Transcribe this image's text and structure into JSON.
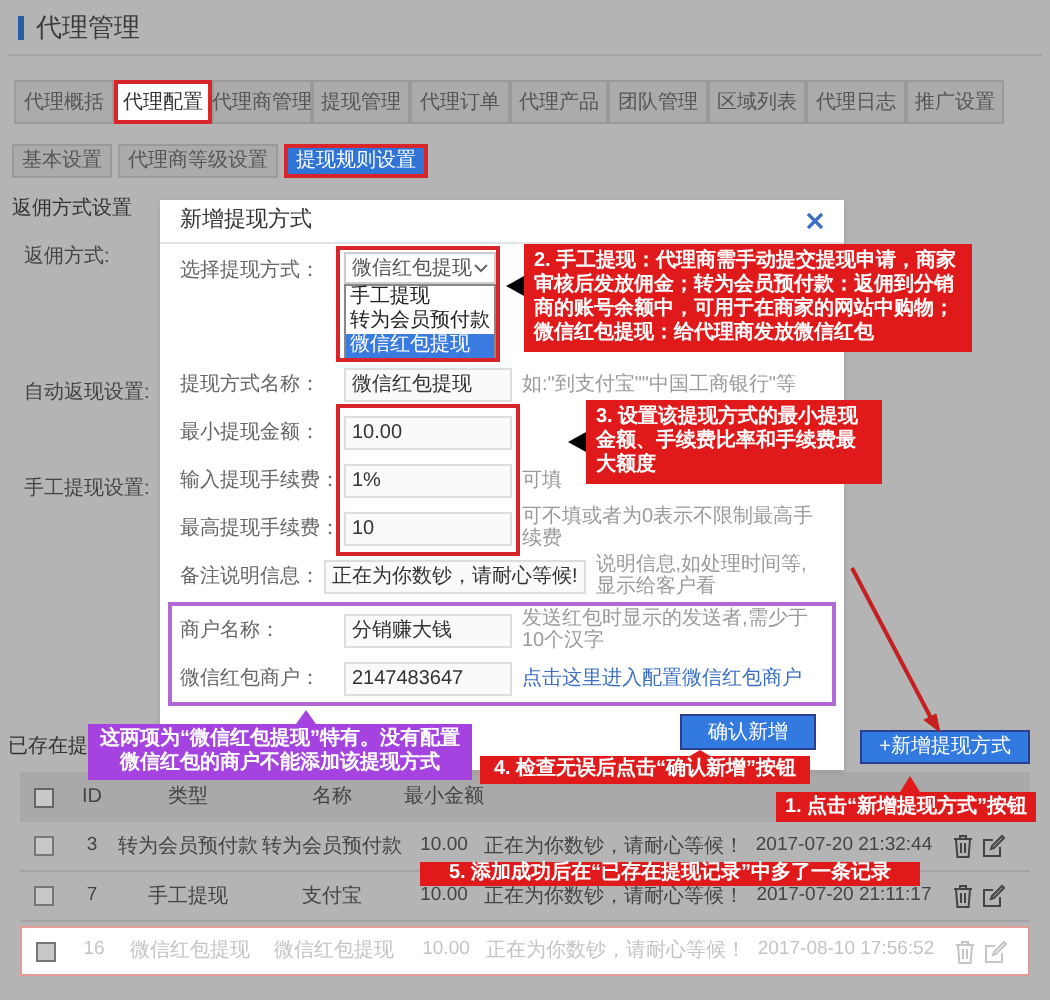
{
  "page_title": "代理管理",
  "tabs": [
    {
      "label": "代理概括",
      "selected": false
    },
    {
      "label": "代理配置",
      "selected": true
    },
    {
      "label": "代理商管理",
      "selected": false
    },
    {
      "label": "提现管理",
      "selected": false
    },
    {
      "label": "代理订单",
      "selected": false
    },
    {
      "label": "代理产品",
      "selected": false
    },
    {
      "label": "团队管理",
      "selected": false
    },
    {
      "label": "区域列表",
      "selected": false
    },
    {
      "label": "代理日志",
      "selected": false
    },
    {
      "label": "推广设置",
      "selected": false
    }
  ],
  "subtabs": [
    {
      "label": "基本设置",
      "selected": false
    },
    {
      "label": "代理商等级设置",
      "selected": false
    },
    {
      "label": "提现规则设置",
      "selected": true
    }
  ],
  "section_label": "返佣方式设置",
  "side_labels": [
    "返佣方式:",
    "自动返现设置:",
    "手工提现设置:"
  ],
  "records_label": "已存在提",
  "modal": {
    "title": "新增提现方式",
    "select": {
      "label": "选择提现方式：",
      "value": "微信红包提现",
      "options": [
        {
          "label": "手工提现",
          "selected": false
        },
        {
          "label": "转为会员预付款",
          "selected": false
        },
        {
          "label": "微信红包提现",
          "selected": true
        }
      ]
    },
    "fields": [
      {
        "kind": "common",
        "label": "提现方式名称：",
        "value": "微信红包提现",
        "hint": "如:\"到支付宝\"\"中国工商银行\"等"
      },
      {
        "kind": "common",
        "label": "最小提现金额：",
        "value": "10.00"
      },
      {
        "kind": "common",
        "label": "输入提现手续费：",
        "value": "1%",
        "hint": "可填"
      },
      {
        "kind": "common",
        "label": "最高提现手续费：",
        "value": "10",
        "hint": "可不填或者为0表示不限制最高手续费"
      },
      {
        "kind": "common",
        "label": "备注说明信息：",
        "value": "正在为你数钞，请耐心等候!",
        "hint": "说明信息,如处理时间等,显示给客户看"
      },
      {
        "kind": "wechat",
        "label": "商户名称：",
        "value": "分销赚大钱",
        "hint": "发送红包时显示的发送者,需少于10个汉字"
      },
      {
        "kind": "wechat",
        "label": "微信红包商户：",
        "value": "2147483647",
        "link": "点击这里进入配置微信红包商户"
      }
    ],
    "confirm_button": "确认新增"
  },
  "add_button": "+新增提现方式",
  "table": {
    "select_all_checked": false,
    "columns": [
      "ID",
      "类型",
      "名称",
      "最小金额"
    ],
    "rows": [
      {
        "checked": false,
        "highlighted": false,
        "cells": [
          "3",
          "转为会员预付款",
          "转为会员预付款",
          "10.00",
          "正在为你数钞，请耐心等候！",
          "2017-07-20 21:32:44"
        ]
      },
      {
        "checked": false,
        "highlighted": false,
        "cells": [
          "7",
          "手工提现",
          "支付宝",
          "10.00",
          "正在为你数钞，请耐心等候！",
          "2017-07-20 21:11:17"
        ]
      },
      {
        "checked": false,
        "highlighted": true,
        "cells": [
          "16",
          "微信红包提现",
          "微信红包提现",
          "10.00",
          "正在为你数钞，请耐心等候！",
          "2017-08-10 17:56:52"
        ]
      }
    ]
  },
  "annotations": [
    {
      "kind": "red",
      "text": "1. 点击“新增提现方式”按钮"
    },
    {
      "kind": "red",
      "text": "2. 手工提现：代理商需手动提交提现申请，商家审核后发放佣金；转为会员预付款：返佣到分销商的账号余额中，可用于在商家的网站中购物；微信红包提现：给代理商发放微信红包"
    },
    {
      "kind": "red",
      "text": "3. 设置该提现方式的最小提现金额、手续费比率和手续费最大额度"
    },
    {
      "kind": "red",
      "text": "4. 检查无误后点击“确认新增”按钮"
    },
    {
      "kind": "red",
      "text": "5. 添加成功后在“已存在提现记录”中多了一条记录"
    },
    {
      "kind": "purple",
      "text": "这两项为“微信红包提现”特有。没有配置微信红包的商户不能添加该提现方式"
    }
  ]
}
